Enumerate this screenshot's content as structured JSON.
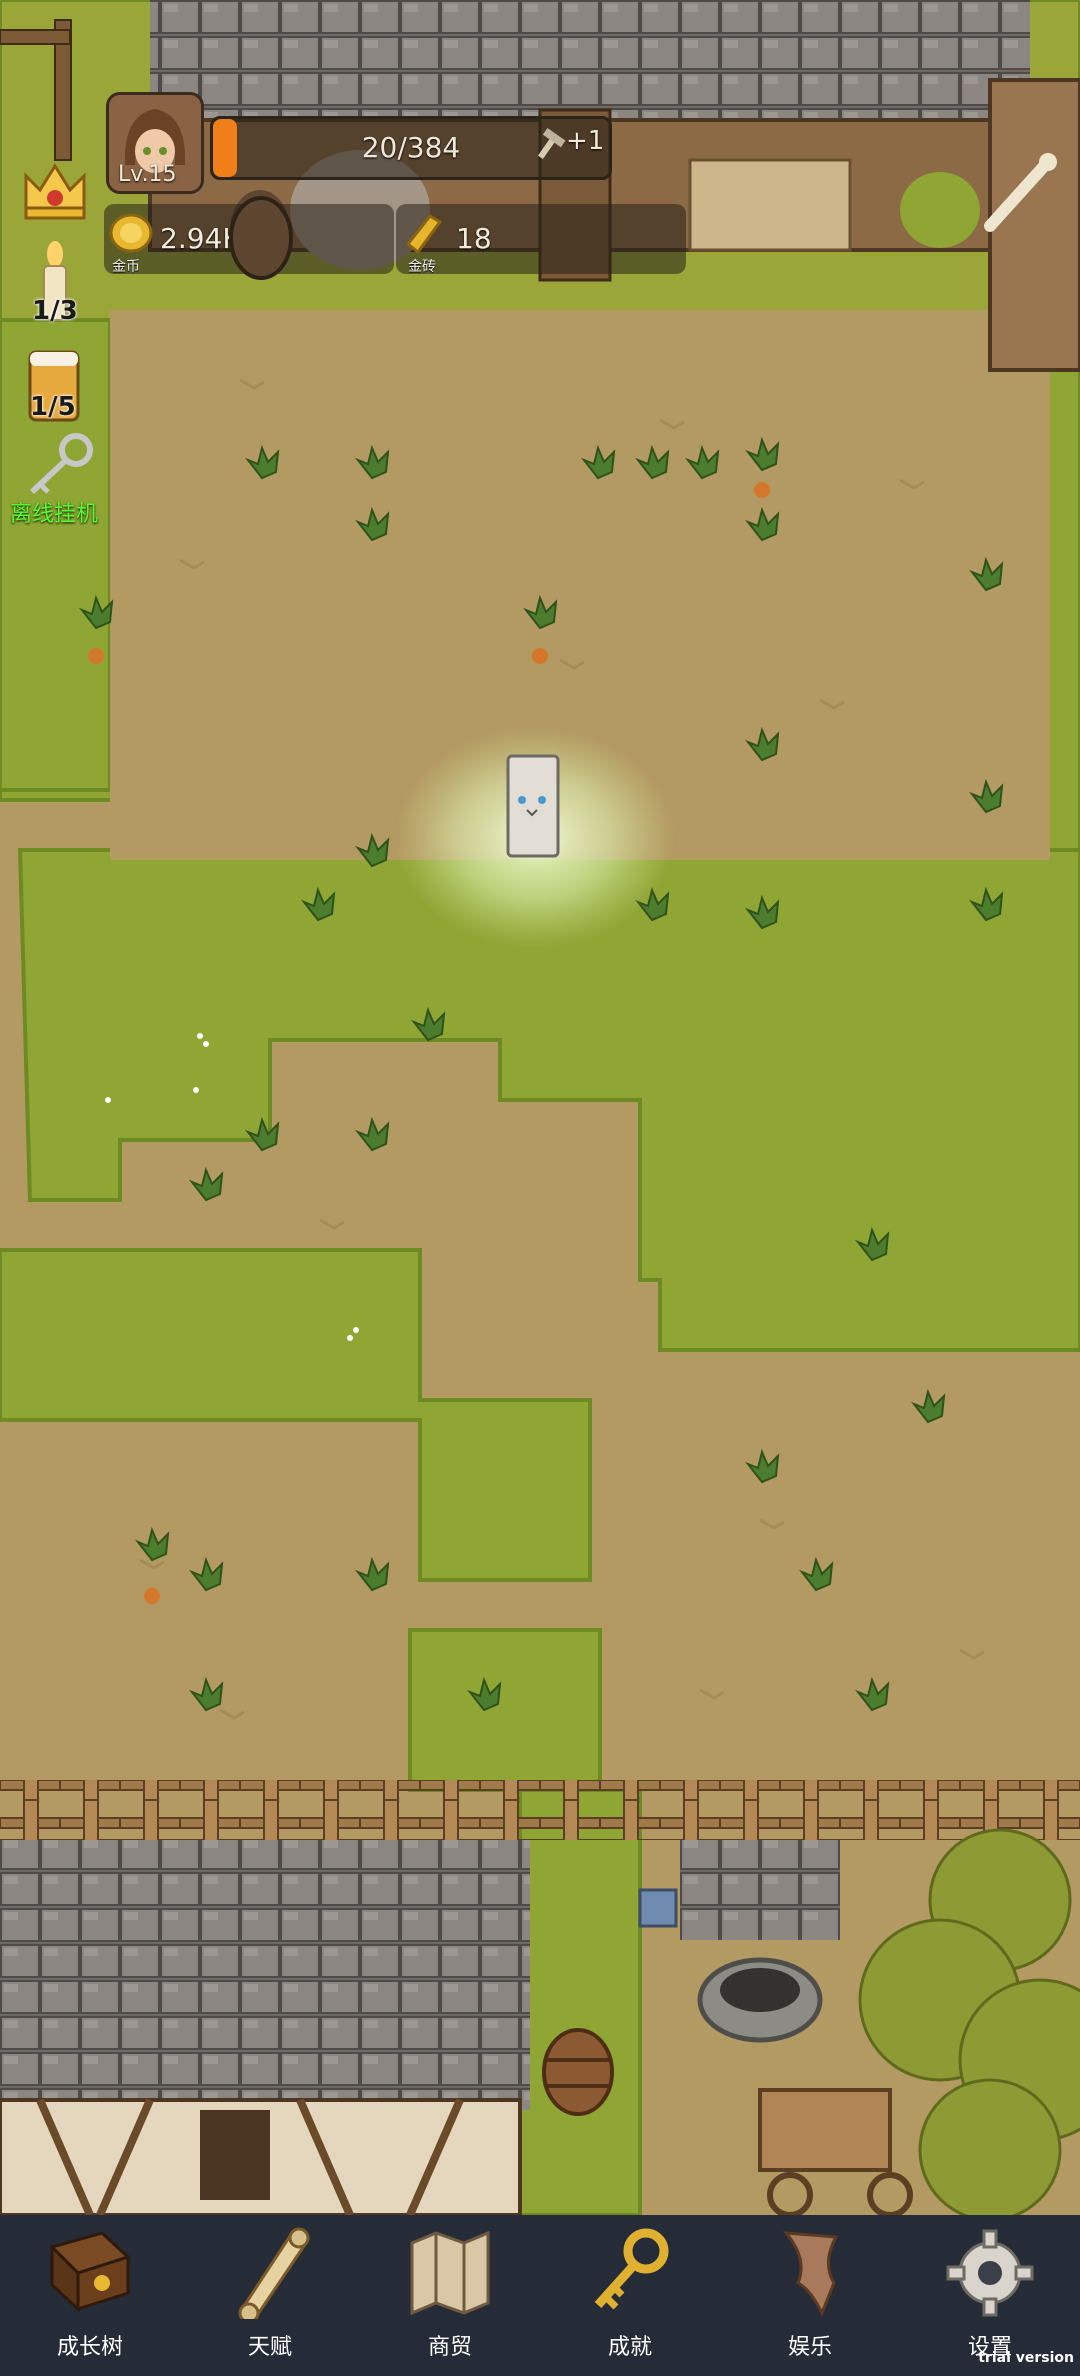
{
  "hud": {
    "level": "Lv.15",
    "xp_text": "20/384",
    "xp_progress": 0.052,
    "xp_bonus": "+1",
    "coins": {
      "value": "2.94K",
      "caption": "金币",
      "icon": "gold-coin-icon"
    },
    "gold_bars": {
      "value": "18",
      "caption": "金砖",
      "icon": "gold-bar-icon"
    }
  },
  "side_items": {
    "crown": {
      "icon": "crown-icon"
    },
    "candle": {
      "icon": "candle-icon",
      "count": "1/3"
    },
    "beer": {
      "icon": "beer-icon",
      "count": "1/5"
    },
    "afk": {
      "icon": "key-icon",
      "label": "离线挂机"
    }
  },
  "nav": [
    {
      "label": "成长树",
      "icon": "growth-book-icon"
    },
    {
      "label": "天赋",
      "icon": "talent-scroll-icon"
    },
    {
      "label": "商贸",
      "icon": "trade-map-icon"
    },
    {
      "label": "成就",
      "icon": "achievement-key-icon"
    },
    {
      "label": "娱乐",
      "icon": "entertainment-scroll-icon"
    },
    {
      "label": "设置",
      "icon": "settings-gear-icon"
    }
  ],
  "watermark": "trial version",
  "colors": {
    "grass": "#8fa534",
    "dirt": "#b39a62",
    "nav_bg": "#252b37",
    "xp_fill": "#f07f1a",
    "afk_text": "#52ff2c"
  }
}
